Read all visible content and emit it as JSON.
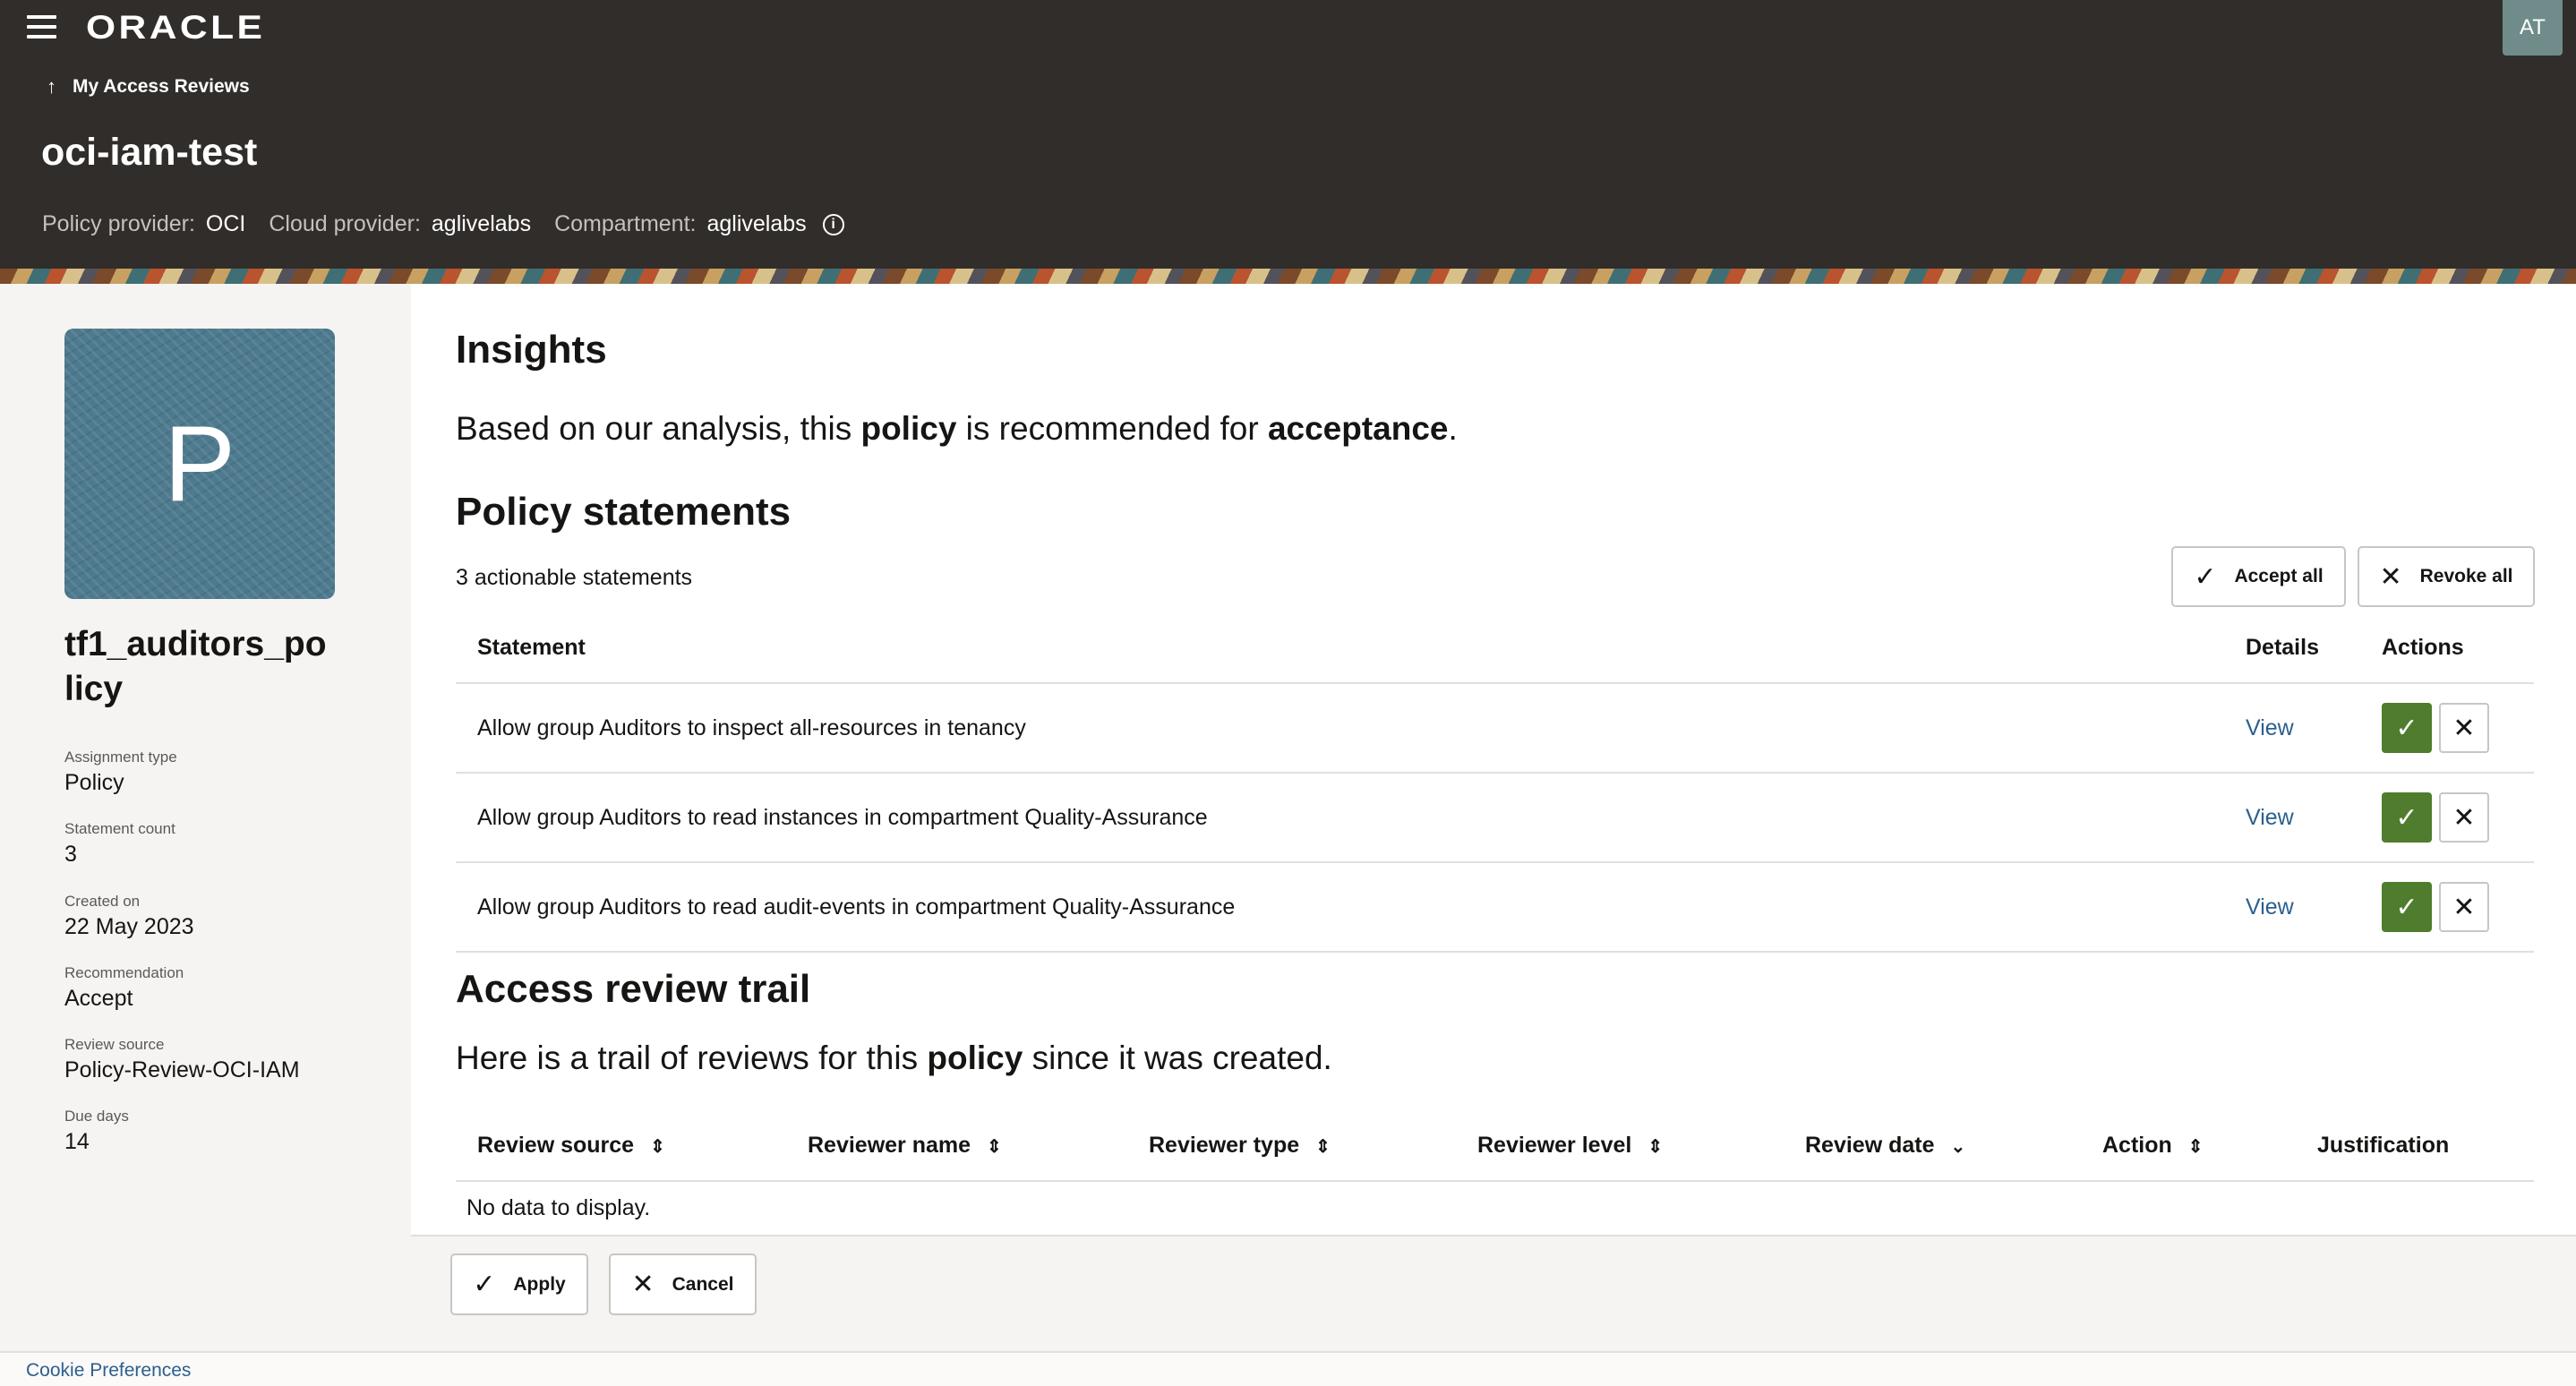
{
  "header": {
    "logo": "ORACLE",
    "avatar_initials": "AT",
    "back_link": "My Access Reviews",
    "title": "oci-iam-test",
    "meta": [
      {
        "label": "Policy provider:",
        "value": "OCI"
      },
      {
        "label": "Cloud provider:",
        "value": "aglivelabs"
      },
      {
        "label": "Compartment:",
        "value": "aglivelabs"
      }
    ]
  },
  "sidebar": {
    "tile_letter": "P",
    "name": "tf1_auditors_policy",
    "attributes": [
      {
        "label": "Assignment type",
        "value": "Policy"
      },
      {
        "label": "Statement count",
        "value": "3"
      },
      {
        "label": "Created on",
        "value": "22 May 2023"
      },
      {
        "label": "Recommendation",
        "value": "Accept"
      },
      {
        "label": "Review source",
        "value": "Policy-Review-OCI-IAM"
      },
      {
        "label": "Due days",
        "value": "14"
      }
    ]
  },
  "insights": {
    "heading": "Insights",
    "text_1": "Based on our analysis, this ",
    "bold_1": "policy",
    "text_2": " is recommended for ",
    "bold_2": "acceptance",
    "text_3": "."
  },
  "policy": {
    "heading": "Policy statements",
    "count_text": "3 actionable statements",
    "accept_all": "Accept all",
    "revoke_all": "Revoke all",
    "columns": [
      "Statement",
      "Details",
      "Actions"
    ],
    "rows": [
      {
        "statement": "Allow group Auditors to inspect all-resources in tenancy",
        "details": "View"
      },
      {
        "statement": "Allow group Auditors to read instances in compartment Quality-Assurance",
        "details": "View"
      },
      {
        "statement": "Allow group Auditors to read audit-events in compartment Quality-Assurance",
        "details": "View"
      }
    ]
  },
  "trail": {
    "heading": "Access review trail",
    "text_1": "Here is a trail of reviews for this ",
    "bold_1": "policy",
    "text_2": " since it was created.",
    "columns": [
      "Review source",
      "Reviewer name",
      "Reviewer type",
      "Reviewer level",
      "Review date",
      "Action",
      "Justification"
    ],
    "empty": "No data to display."
  },
  "footer": {
    "apply": "Apply",
    "cancel": "Cancel",
    "cookie": "Cookie Preferences"
  }
}
